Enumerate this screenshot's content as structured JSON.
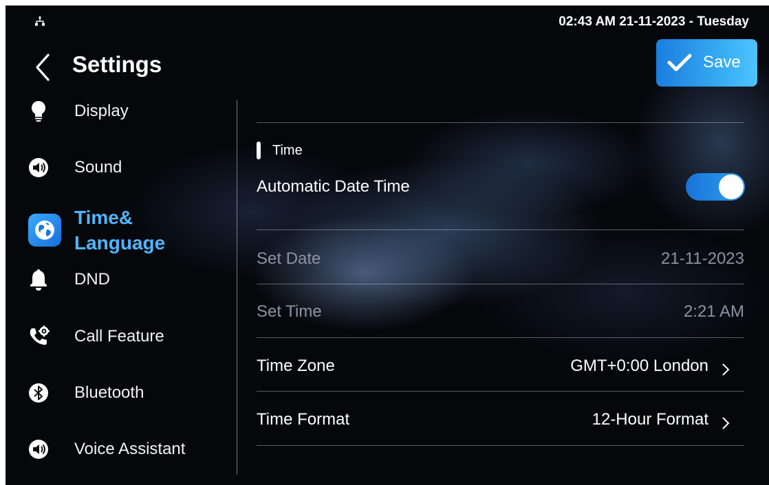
{
  "status_bar": {
    "time_date": "02:43 AM  21-11-2023 - Tuesday",
    "network_icon": "network-icon"
  },
  "header": {
    "title": "Settings",
    "save_label": "Save"
  },
  "sidebar": {
    "items": [
      {
        "label": "Display",
        "icon": "lightbulb-icon"
      },
      {
        "label": "Sound",
        "icon": "speaker-icon"
      },
      {
        "label": "Time&\nLanguage",
        "icon": "globe-icon",
        "active": true
      },
      {
        "label": "DND",
        "icon": "bell-icon"
      },
      {
        "label": "Call Feature",
        "icon": "phone-gear-icon"
      },
      {
        "label": "Bluetooth",
        "icon": "bluetooth-icon"
      },
      {
        "label": "Voice Assistant",
        "icon": "speaker-icon"
      }
    ]
  },
  "content": {
    "section_title": "Time",
    "rows": [
      {
        "label": "Automatic Date Time",
        "toggle_on": true
      },
      {
        "label": "Set Date",
        "value": "21-11-2023",
        "disabled": true
      },
      {
        "label": "Set Time",
        "value": "2:21 AM",
        "disabled": true
      },
      {
        "label": "Time Zone",
        "value": "GMT+0:00 London"
      },
      {
        "label": "Time Format",
        "value": "12-Hour Format"
      }
    ]
  },
  "colors": {
    "accent": "#4fb6ff",
    "toggle": "#1f86e6",
    "disabled_text": "#8b93a3",
    "background": "#05070b"
  }
}
